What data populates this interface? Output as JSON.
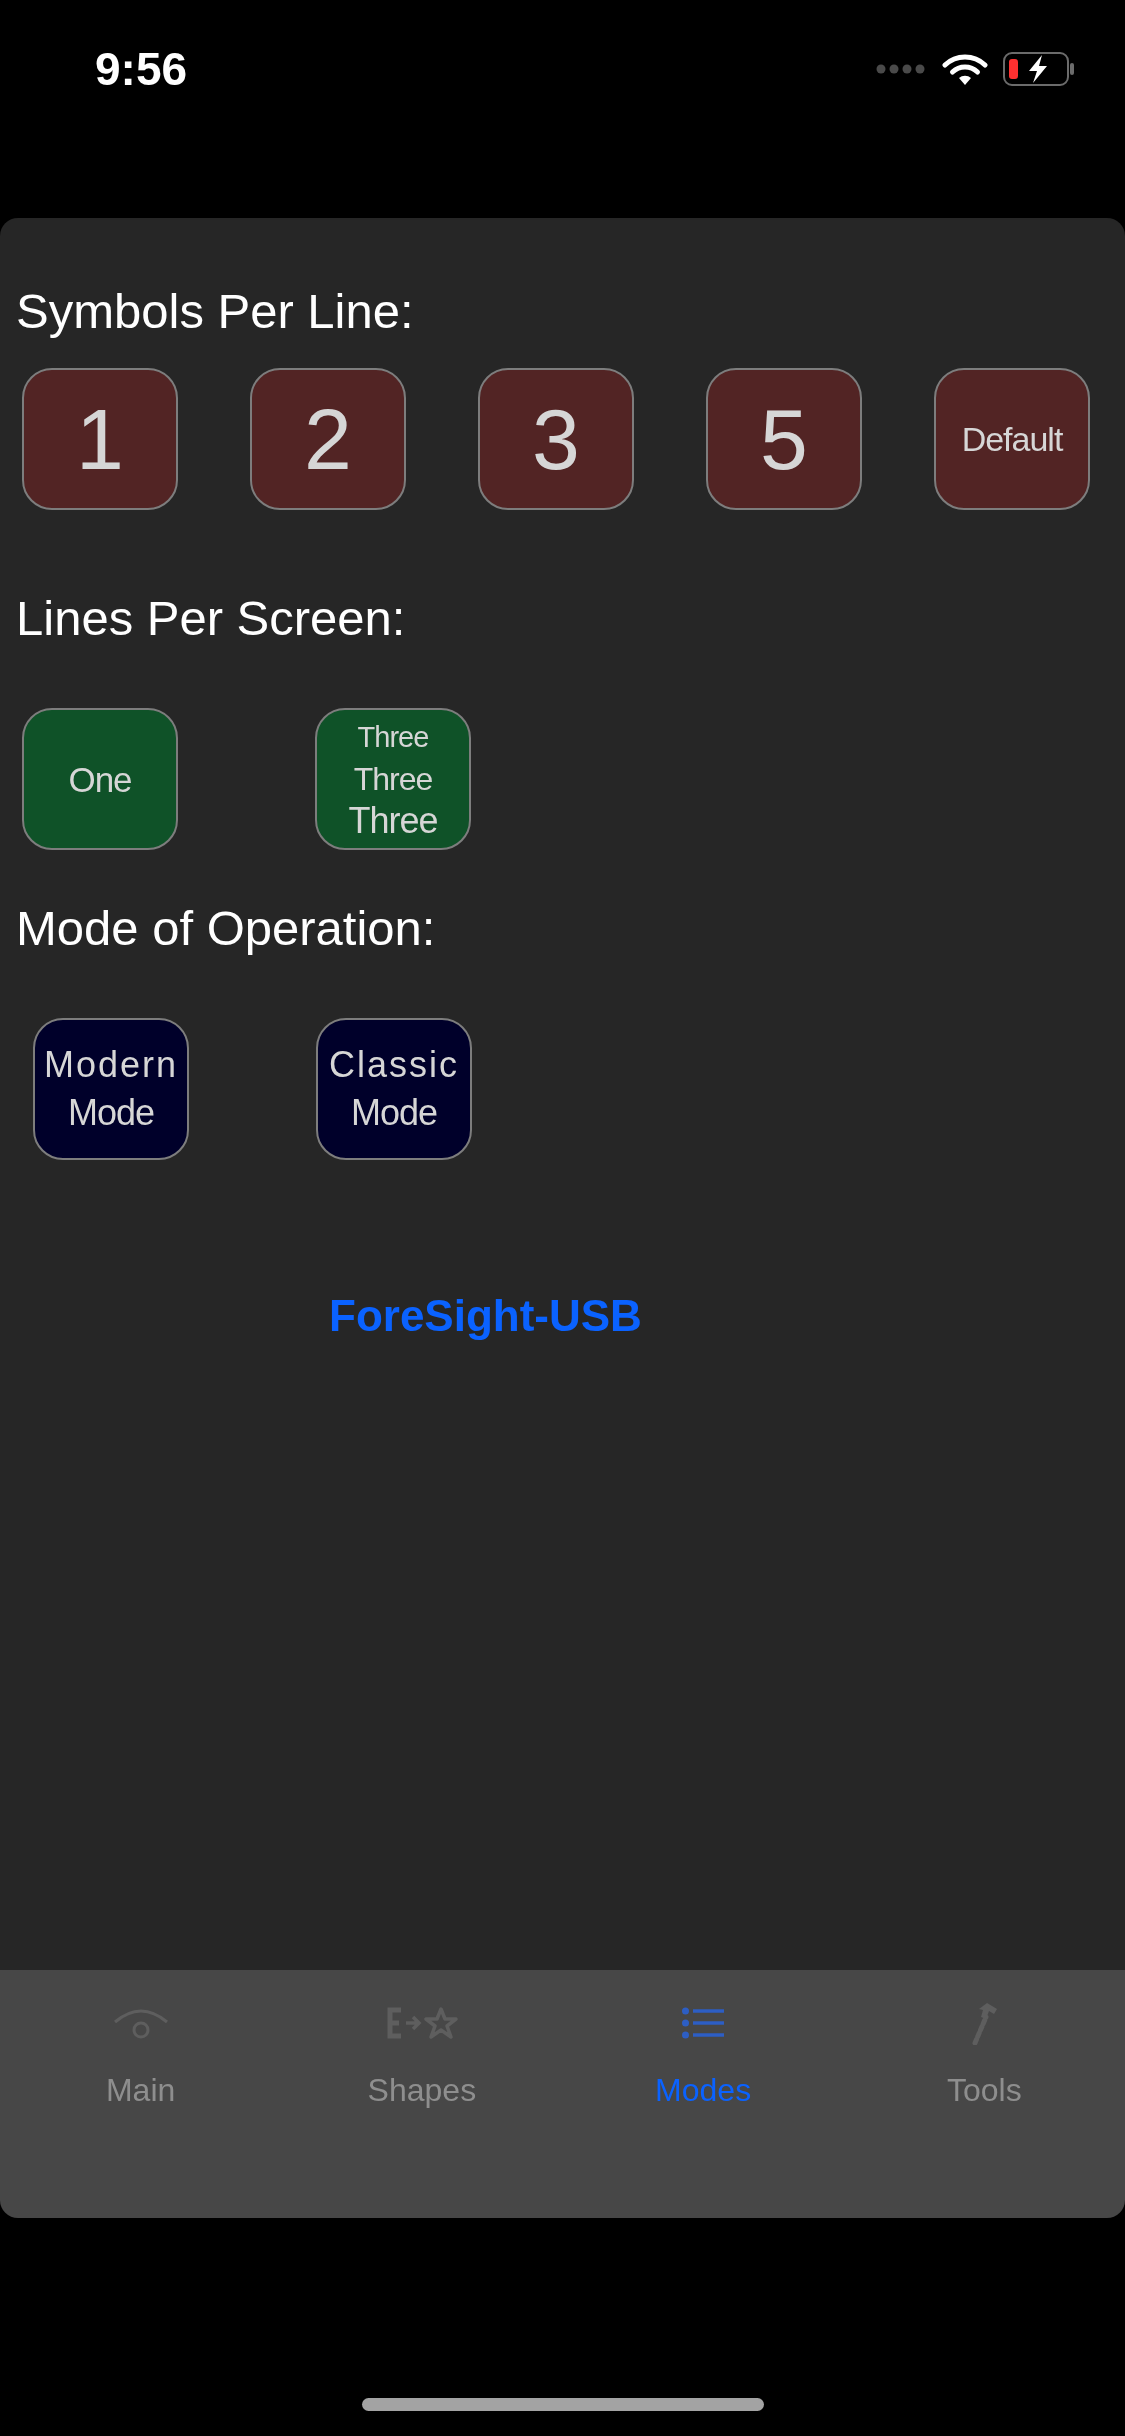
{
  "status_bar": {
    "time": "9:56"
  },
  "sections": [
    {
      "kind": "symbols",
      "title": "Symbols Per Line:",
      "buttons": [
        {
          "kind": "digit",
          "lines": [
            "1"
          ]
        },
        {
          "kind": "digit",
          "lines": [
            "2"
          ]
        },
        {
          "kind": "digit",
          "lines": [
            "3"
          ]
        },
        {
          "kind": "digit",
          "lines": [
            "5"
          ]
        },
        {
          "kind": "word",
          "lines": [
            "Default"
          ]
        }
      ]
    },
    {
      "kind": "lines",
      "title": "Lines Per Screen:",
      "buttons": [
        {
          "kind": "word",
          "lines": [
            "One"
          ]
        },
        {
          "kind": "stack",
          "lines": [
            "Three",
            "Three",
            "Three"
          ]
        }
      ]
    },
    {
      "kind": "mode",
      "title": "Mode of Operation:",
      "buttons": [
        {
          "kind": "pair",
          "lines": [
            "Modern",
            "Mode"
          ]
        },
        {
          "kind": "pair",
          "lines": [
            "Classic",
            "Mode"
          ]
        }
      ]
    }
  ],
  "footer": {
    "title": "ForeSight-USB"
  },
  "tabs": [
    {
      "label": "Main",
      "selected": false
    },
    {
      "label": "Shapes",
      "selected": false
    },
    {
      "label": "Modes",
      "selected": true
    },
    {
      "label": "Tools",
      "selected": false
    }
  ]
}
